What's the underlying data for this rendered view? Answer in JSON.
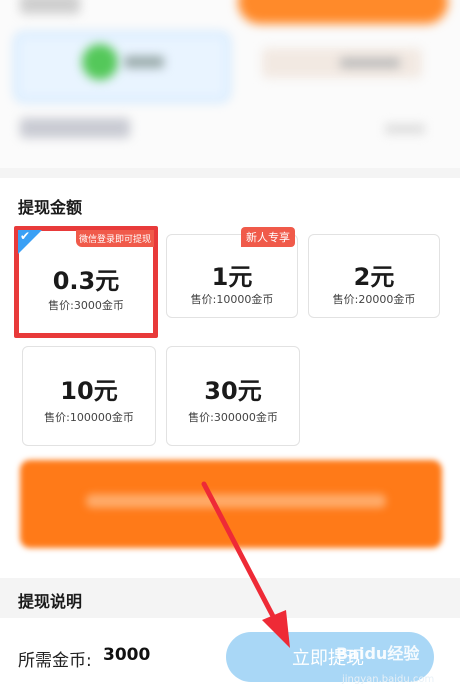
{
  "section": {
    "title": "提现金额"
  },
  "options": [
    {
      "amount": "0.3元",
      "price": "售价:3000金币",
      "tag": "微信登录即可提现",
      "selected": true
    },
    {
      "amount": "1元",
      "price": "售价:10000金币",
      "tag": "新人专享",
      "selected": false
    },
    {
      "amount": "2元",
      "price": "售价:20000金币",
      "tag": "",
      "selected": false
    },
    {
      "amount": "10元",
      "price": "售价:100000金币",
      "tag": "",
      "selected": false
    },
    {
      "amount": "30元",
      "price": "售价:300000金币",
      "tag": "",
      "selected": false
    }
  ],
  "description": {
    "title": "提现说明"
  },
  "bottom": {
    "coins_label": "所需金币:",
    "coins_value": "3000",
    "withdraw_label": "立即提现"
  },
  "watermark": {
    "text": "Baidu经验",
    "url": "jingyan.baidu.com"
  },
  "colors": {
    "selected_border": "#e83a3a",
    "check_corner": "#3aa0f5",
    "tag": "#f05a4a",
    "orange_button": "#ff7a18",
    "withdraw_button": "#a9d7f6"
  }
}
